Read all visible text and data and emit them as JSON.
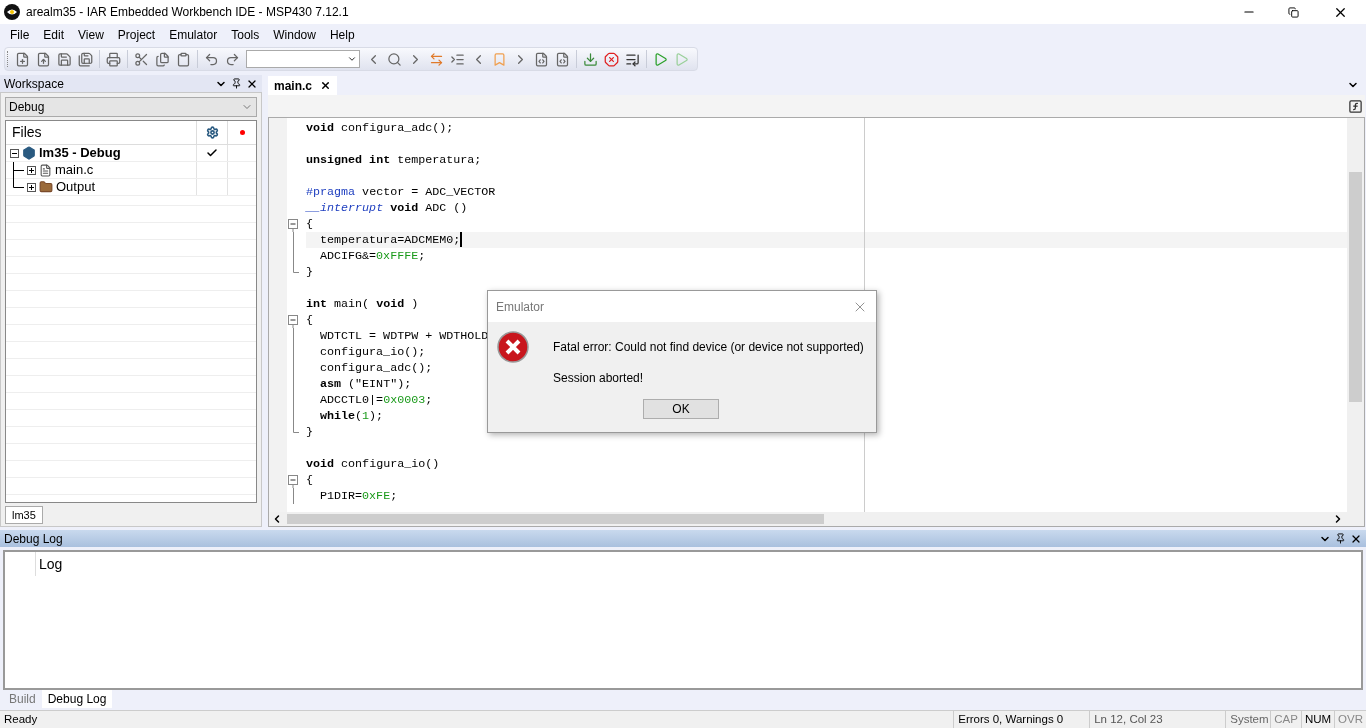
{
  "window": {
    "title": "arealm35 - IAR Embedded Workbench IDE - MSP430 7.12.1"
  },
  "menu": [
    "File",
    "Edit",
    "View",
    "Project",
    "Emulator",
    "Tools",
    "Window",
    "Help"
  ],
  "workspace": {
    "title": "Workspace",
    "configuration": "Debug",
    "columns": [
      "Files"
    ],
    "tree": [
      {
        "label": "lm35 - Debug",
        "kind": "project",
        "expanded": true,
        "checked": true,
        "children": [
          {
            "label": "main.c",
            "kind": "file",
            "expanded": false
          },
          {
            "label": "Output",
            "kind": "folder",
            "expanded": false
          }
        ]
      }
    ],
    "tabs": [
      {
        "label": "lm35",
        "selected": true
      }
    ]
  },
  "editor": {
    "tabs": [
      {
        "label": "main.c",
        "selected": true
      }
    ],
    "lines": [
      {
        "tokens": [
          {
            "kind": "kw",
            "text": "void"
          },
          {
            "kind": "text",
            "text": " configura_adc();"
          }
        ]
      },
      {
        "kind": "blank"
      },
      {
        "tokens": [
          {
            "kind": "kw",
            "text": "unsigned int"
          },
          {
            "kind": "text",
            "text": " temperatura;"
          }
        ]
      },
      {
        "kind": "blank"
      },
      {
        "tokens": [
          {
            "kind": "pp",
            "text": "#pragma"
          },
          {
            "kind": "text",
            "text": " vector = ADC_VECTOR"
          }
        ]
      },
      {
        "tokens": [
          {
            "kind": "ikw",
            "text": "__interrupt"
          },
          {
            "kind": "kw",
            "text": "void",
            "space_before": true
          },
          {
            "kind": "text",
            "text": "ADC ()",
            "space_before": true
          }
        ]
      },
      {
        "fold_open": true,
        "tokens": [
          {
            "kind": "text",
            "text": "{"
          }
        ]
      },
      {
        "indented": true,
        "current": true,
        "tokens": [
          {
            "kind": "text",
            "text": "temperatura=ADCMEM0;"
          }
        ]
      },
      {
        "indented": true,
        "tokens": [
          {
            "kind": "text",
            "text": "ADCIFG&="
          },
          {
            "kind": "num",
            "text": "0xFFFE"
          },
          {
            "kind": "text",
            "text": ";"
          }
        ]
      },
      {
        "fold_end": true,
        "tokens": [
          {
            "kind": "text",
            "text": "}"
          }
        ]
      },
      {
        "kind": "blank"
      },
      {
        "tokens": [
          {
            "kind": "kw",
            "text": "int"
          },
          {
            "kind": "text",
            "text": " main( "
          },
          {
            "kind": "kw",
            "text": "void"
          },
          {
            "kind": "text",
            "text": " )"
          }
        ]
      },
      {
        "fold_open": true,
        "tokens": [
          {
            "kind": "text",
            "text": "{"
          }
        ]
      },
      {
        "indented": true,
        "tokens": [
          {
            "kind": "text",
            "text": "WDTCTL = WDTPW + WDTHOLD"
          }
        ]
      },
      {
        "indented": true,
        "tokens": [
          {
            "kind": "text",
            "text": "configura_io();"
          }
        ]
      },
      {
        "indented": true,
        "tokens": [
          {
            "kind": "text",
            "text": "configura_adc();"
          }
        ]
      },
      {
        "indented": true,
        "tokens": [
          {
            "kind": "kw",
            "text": "asm"
          },
          {
            "kind": "text",
            "text": " (\"EINT\");"
          }
        ]
      },
      {
        "indented": true,
        "tokens": [
          {
            "kind": "text",
            "text": "ADCCTL0|="
          },
          {
            "kind": "num",
            "text": "0x0003"
          },
          {
            "kind": "text",
            "text": ";"
          }
        ]
      },
      {
        "indented": true,
        "tokens": [
          {
            "kind": "kw",
            "text": "while"
          },
          {
            "kind": "text",
            "text": "("
          },
          {
            "kind": "num",
            "text": "1"
          },
          {
            "kind": "text",
            "text": ");"
          }
        ]
      },
      {
        "fold_end": true,
        "tokens": [
          {
            "kind": "text",
            "text": "}"
          }
        ]
      },
      {
        "kind": "blank"
      },
      {
        "tokens": [
          {
            "kind": "kw",
            "text": "void"
          },
          {
            "kind": "text",
            "text": " configura_io()"
          }
        ]
      },
      {
        "fold_open": true,
        "tokens": [
          {
            "kind": "text",
            "text": "{"
          }
        ]
      },
      {
        "indented": true,
        "tokens": [
          {
            "kind": "text",
            "text": "P1DIR="
          },
          {
            "kind": "num",
            "text": "0xFE"
          },
          {
            "kind": "text",
            "text": ";"
          }
        ]
      }
    ]
  },
  "dialog": {
    "title": "Emulator",
    "message": "Fatal error: Could not find device (or device not supported)",
    "detail": "Session aborted!",
    "buttons": [
      "OK"
    ]
  },
  "debug_log": {
    "title": "Debug Log",
    "column": "Log",
    "tabs": [
      {
        "label": "Build",
        "selected": false
      },
      {
        "label": "Debug Log",
        "selected": true
      }
    ]
  },
  "status_bar": {
    "message": "Ready",
    "build": "Errors 0, Warnings 0",
    "position": "Ln 12, Col 23",
    "mode": "System",
    "indicators": [
      {
        "label": "CAP",
        "on": false
      },
      {
        "label": "NUM",
        "on": true
      },
      {
        "label": "OVR",
        "on": false
      }
    ]
  }
}
